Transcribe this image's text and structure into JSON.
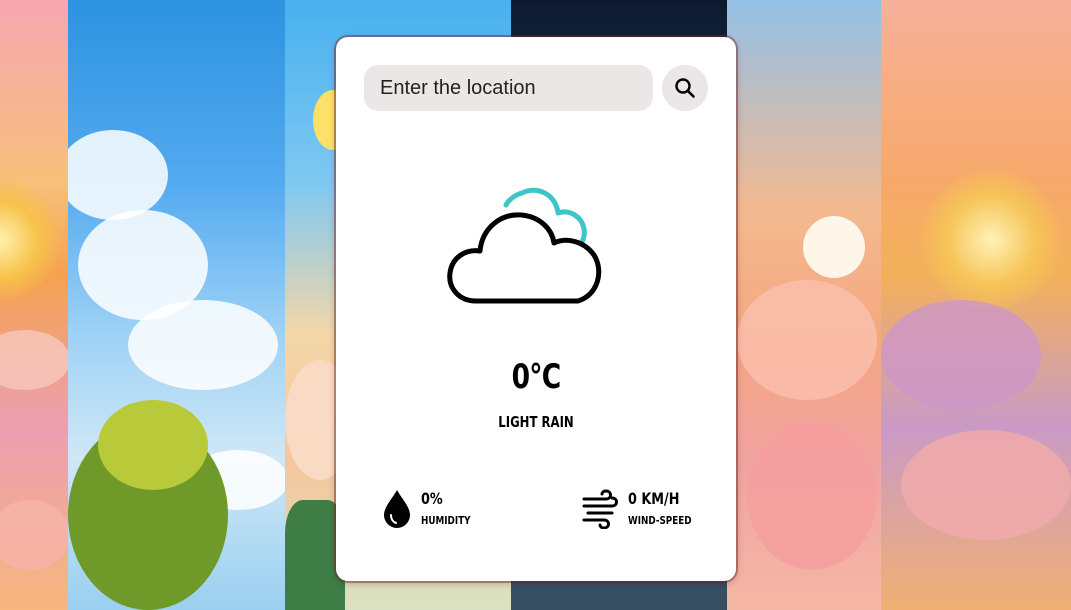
{
  "search": {
    "placeholder": "Enter the location",
    "button_icon": "search-icon"
  },
  "weather": {
    "icon": "cloud-icon",
    "temperature": "0°C",
    "condition": "LIGHT RAIN"
  },
  "details": {
    "humidity": {
      "icon": "water-drop-icon",
      "value": "0%",
      "label": "HUMIDITY"
    },
    "wind": {
      "icon": "wind-icon",
      "value": "0 KM/H",
      "label": "WIND-SPEED"
    }
  },
  "colors": {
    "card_background": "#ffffff",
    "input_background": "#ebe7e6",
    "cloud_accent": "#3cc6c8",
    "text": "#000000"
  }
}
